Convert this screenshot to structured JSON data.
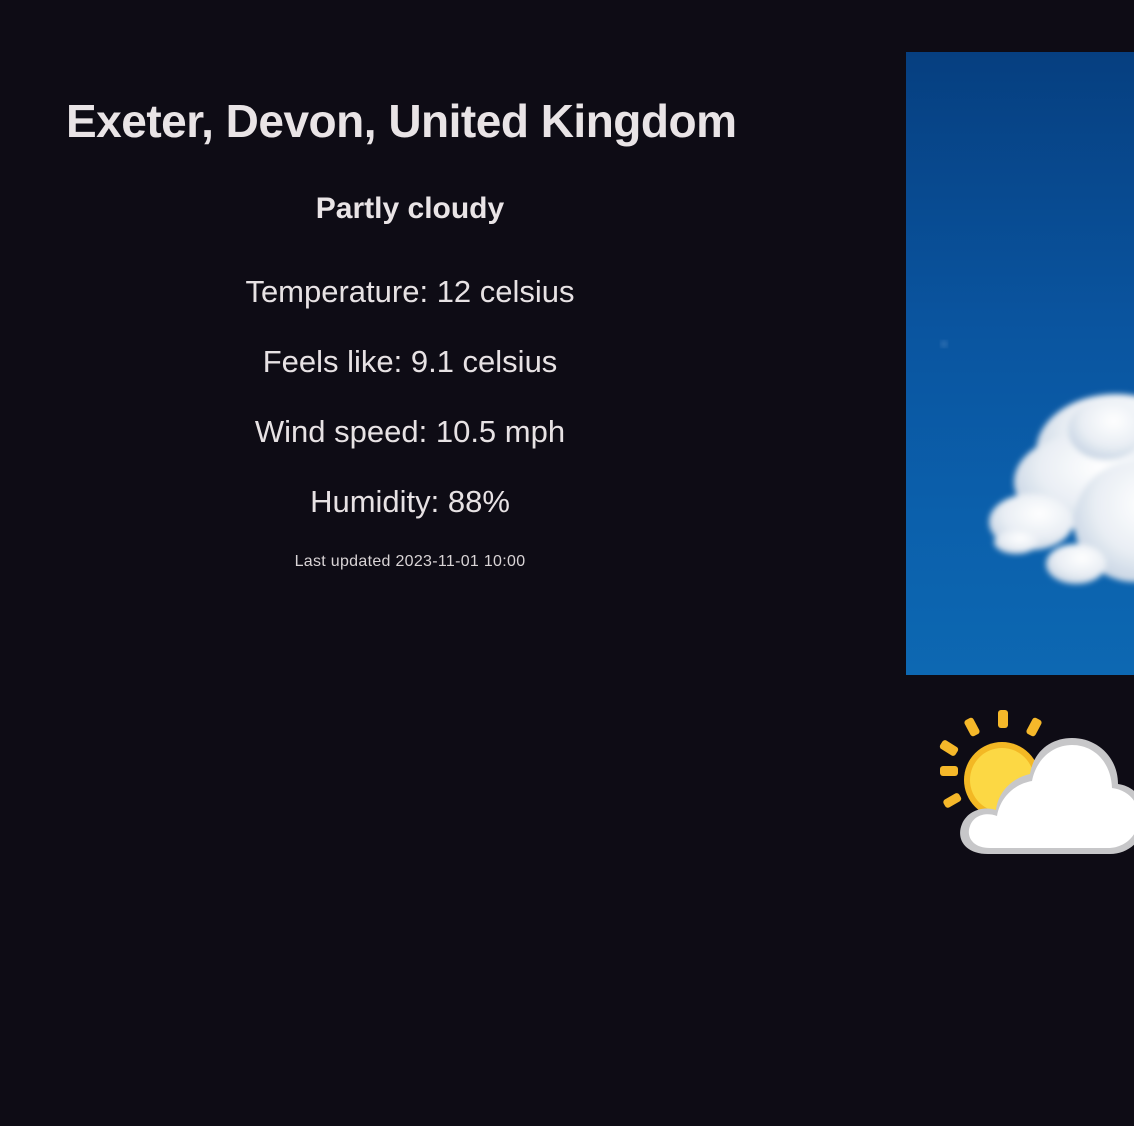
{
  "location": {
    "title": "Exeter, Devon, United Kingdom"
  },
  "current": {
    "condition": "Partly cloudy",
    "temperature_text": "Temperature: 12 celsius",
    "feels_like_text": "Feels like: 9.1 celsius",
    "wind_speed_text": "Wind speed: 10.5 mph",
    "humidity_text": "Humidity: 88%",
    "last_updated_text": "Last updated 2023-11-01 10:00"
  },
  "media": {
    "background_photo": "sky-with-cloud-photo",
    "condition_icon": "partly-cloudy-icon"
  },
  "colors": {
    "page_background": "#0e0c15",
    "text": "#e7e2e4",
    "sky_top": "#063f80",
    "sky_bottom": "#0d68b2",
    "sun": "#f5b82a"
  }
}
